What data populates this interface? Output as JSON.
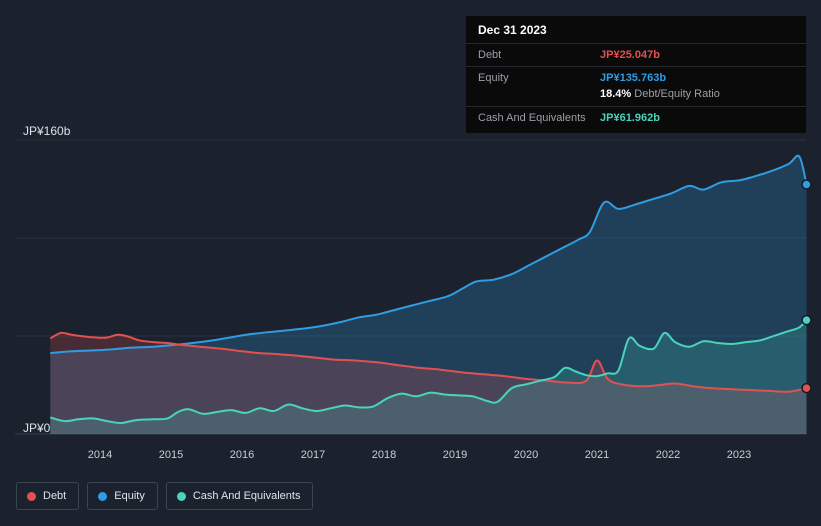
{
  "colors": {
    "background": "#1b222d",
    "debt": "#e25151",
    "equity": "#2f9ce4",
    "cash": "#4ad3bd"
  },
  "tooltip": {
    "date": "Dec 31 2023",
    "debt_label": "Debt",
    "debt_value": "JP¥25.047b",
    "equity_label": "Equity",
    "equity_value": "JP¥135.763b",
    "ratio_value": "18.4%",
    "ratio_label": "Debt/Equity Ratio",
    "cash_label": "Cash And Equivalents",
    "cash_value": "JP¥61.962b"
  },
  "y_axis": {
    "top_label": "JP¥160b",
    "bottom_label": "JP¥0"
  },
  "legend": {
    "items": [
      {
        "label": "Debt",
        "color": "#e25151"
      },
      {
        "label": "Equity",
        "color": "#2f9ce4"
      },
      {
        "label": "Cash And Equivalents",
        "color": "#4ad3bd"
      }
    ]
  },
  "chart_data": {
    "type": "area",
    "title": "Debt, Equity and Cash history",
    "x_tick_labels": [
      "2014",
      "2015",
      "2016",
      "2017",
      "2018",
      "2019",
      "2020",
      "2021",
      "2022",
      "2023"
    ],
    "x_range": [
      2013.3,
      2023.95
    ],
    "y_range": [
      0,
      160
    ],
    "y_unit": "JP¥ billions",
    "gridline_values": [
      0,
      53.33,
      106.67,
      160
    ],
    "grid": true,
    "legend_position": "bottom-left",
    "series": [
      {
        "name": "Debt",
        "color": "#e25151",
        "fill": "rgba(226,81,81,0.22)",
        "end_value": 25.047,
        "points": [
          [
            2013.3,
            52
          ],
          [
            2013.45,
            55
          ],
          [
            2013.6,
            54
          ],
          [
            2013.8,
            53
          ],
          [
            2013.95,
            52.5
          ],
          [
            2014.1,
            52.5
          ],
          [
            2014.25,
            54
          ],
          [
            2014.4,
            53
          ],
          [
            2014.55,
            51
          ],
          [
            2014.75,
            50
          ],
          [
            2014.95,
            49.5
          ],
          [
            2015.15,
            48.5
          ],
          [
            2015.4,
            47.5
          ],
          [
            2015.7,
            46.5
          ],
          [
            2016.0,
            45
          ],
          [
            2016.25,
            44
          ],
          [
            2016.5,
            43.5
          ],
          [
            2016.8,
            42.5
          ],
          [
            2017.05,
            41.5
          ],
          [
            2017.3,
            40.5
          ],
          [
            2017.6,
            40
          ],
          [
            2017.9,
            39
          ],
          [
            2018.2,
            37.5
          ],
          [
            2018.5,
            36
          ],
          [
            2018.8,
            35
          ],
          [
            2019.1,
            33.5
          ],
          [
            2019.4,
            32.5
          ],
          [
            2019.7,
            31.5
          ],
          [
            2020.0,
            30
          ],
          [
            2020.3,
            29
          ],
          [
            2020.6,
            28
          ],
          [
            2020.85,
            29
          ],
          [
            2021.0,
            40
          ],
          [
            2021.15,
            30
          ],
          [
            2021.35,
            27
          ],
          [
            2021.6,
            26
          ],
          [
            2021.85,
            26.5
          ],
          [
            2022.1,
            27.5
          ],
          [
            2022.35,
            26
          ],
          [
            2022.6,
            25
          ],
          [
            2022.85,
            24.5
          ],
          [
            2023.1,
            24
          ],
          [
            2023.4,
            23.5
          ],
          [
            2023.7,
            23
          ],
          [
            2023.95,
            25
          ]
        ]
      },
      {
        "name": "Equity",
        "color": "#2f9ce4",
        "fill": "rgba(47,156,228,0.25)",
        "end_value": 135.763,
        "points": [
          [
            2013.3,
            44
          ],
          [
            2013.6,
            45
          ],
          [
            2013.9,
            45.5
          ],
          [
            2014.15,
            46
          ],
          [
            2014.45,
            47
          ],
          [
            2014.75,
            47.5
          ],
          [
            2015.05,
            48.5
          ],
          [
            2015.3,
            49.5
          ],
          [
            2015.6,
            51
          ],
          [
            2015.9,
            53
          ],
          [
            2016.15,
            54.5
          ],
          [
            2016.4,
            55.5
          ],
          [
            2016.65,
            56.5
          ],
          [
            2016.9,
            57.5
          ],
          [
            2017.15,
            59
          ],
          [
            2017.4,
            61
          ],
          [
            2017.65,
            63.5
          ],
          [
            2017.9,
            65
          ],
          [
            2018.15,
            67.5
          ],
          [
            2018.4,
            70
          ],
          [
            2018.65,
            72.5
          ],
          [
            2018.9,
            75
          ],
          [
            2019.1,
            79
          ],
          [
            2019.3,
            83
          ],
          [
            2019.55,
            84
          ],
          [
            2019.8,
            87
          ],
          [
            2020.05,
            92
          ],
          [
            2020.3,
            97
          ],
          [
            2020.55,
            102
          ],
          [
            2020.75,
            106
          ],
          [
            2020.9,
            110
          ],
          [
            2021.1,
            126
          ],
          [
            2021.3,
            122.5
          ],
          [
            2021.55,
            125
          ],
          [
            2021.8,
            128
          ],
          [
            2022.05,
            131
          ],
          [
            2022.3,
            135
          ],
          [
            2022.5,
            133
          ],
          [
            2022.75,
            137
          ],
          [
            2023.0,
            138
          ],
          [
            2023.2,
            140
          ],
          [
            2023.45,
            143
          ],
          [
            2023.7,
            147
          ],
          [
            2023.85,
            151
          ],
          [
            2023.95,
            135.8
          ]
        ]
      },
      {
        "name": "Cash And Equivalents",
        "color": "#4ad3bd",
        "fill": "rgba(74,211,189,0.20)",
        "end_value": 61.962,
        "points": [
          [
            2013.3,
            9
          ],
          [
            2013.5,
            7
          ],
          [
            2013.7,
            8
          ],
          [
            2013.9,
            8.5
          ],
          [
            2014.1,
            7
          ],
          [
            2014.3,
            6
          ],
          [
            2014.5,
            7.5
          ],
          [
            2014.75,
            8
          ],
          [
            2014.95,
            8.5
          ],
          [
            2015.1,
            12
          ],
          [
            2015.25,
            13.5
          ],
          [
            2015.45,
            11
          ],
          [
            2015.65,
            12
          ],
          [
            2015.85,
            13
          ],
          [
            2016.05,
            11.5
          ],
          [
            2016.25,
            14
          ],
          [
            2016.45,
            12.5
          ],
          [
            2016.65,
            16
          ],
          [
            2016.85,
            14
          ],
          [
            2017.05,
            12.5
          ],
          [
            2017.25,
            14
          ],
          [
            2017.45,
            15.5
          ],
          [
            2017.65,
            14.5
          ],
          [
            2017.85,
            15
          ],
          [
            2018.05,
            19.5
          ],
          [
            2018.25,
            22
          ],
          [
            2018.45,
            20.5
          ],
          [
            2018.65,
            22.5
          ],
          [
            2018.85,
            21.5
          ],
          [
            2019.05,
            21
          ],
          [
            2019.25,
            20.5
          ],
          [
            2019.45,
            18
          ],
          [
            2019.6,
            17.5
          ],
          [
            2019.8,
            25
          ],
          [
            2020.0,
            27
          ],
          [
            2020.2,
            29
          ],
          [
            2020.4,
            31
          ],
          [
            2020.55,
            36
          ],
          [
            2020.7,
            34
          ],
          [
            2020.85,
            32
          ],
          [
            2021.0,
            31.5
          ],
          [
            2021.15,
            33
          ],
          [
            2021.3,
            34.5
          ],
          [
            2021.45,
            52
          ],
          [
            2021.6,
            48
          ],
          [
            2021.8,
            46.5
          ],
          [
            2021.95,
            55
          ],
          [
            2022.1,
            50
          ],
          [
            2022.3,
            47.5
          ],
          [
            2022.5,
            50.5
          ],
          [
            2022.7,
            49.5
          ],
          [
            2022.9,
            49
          ],
          [
            2023.1,
            50
          ],
          [
            2023.3,
            51
          ],
          [
            2023.5,
            53.5
          ],
          [
            2023.7,
            56
          ],
          [
            2023.85,
            58
          ],
          [
            2023.95,
            62
          ]
        ]
      }
    ]
  }
}
